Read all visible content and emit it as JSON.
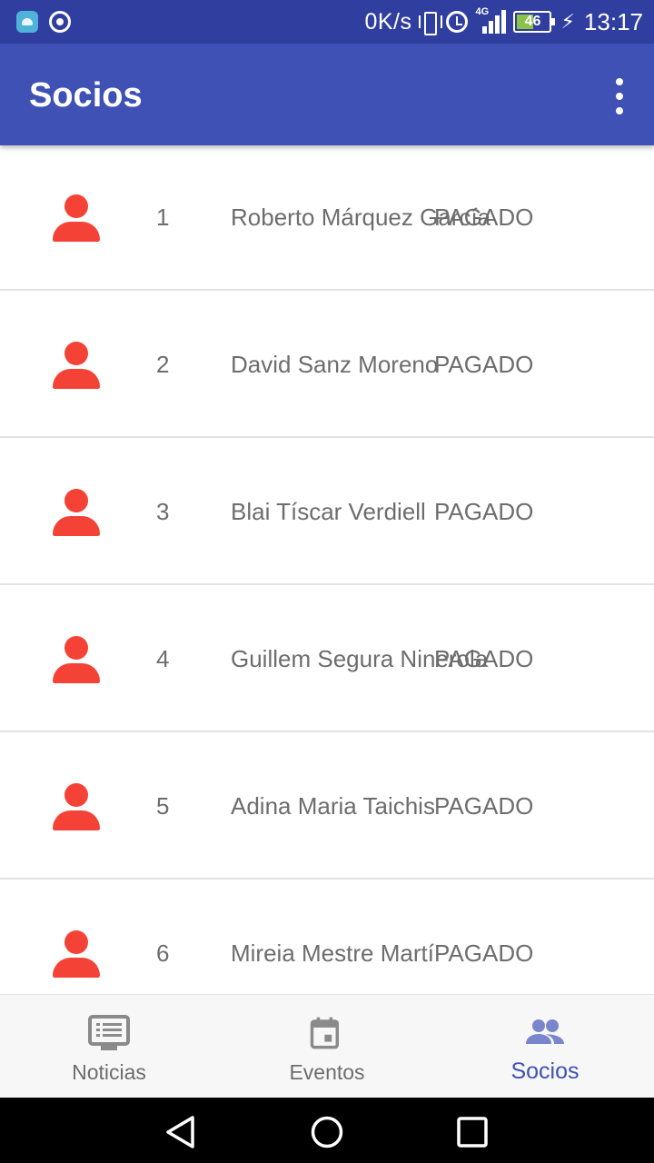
{
  "status_bar": {
    "net_speed": "0K/s",
    "network_type": "4G",
    "battery_level": "46",
    "time": "13:17"
  },
  "app_bar": {
    "title": "Socios",
    "overflow_icon": "more-vert-icon"
  },
  "members": [
    {
      "num": "1",
      "name": "Roberto Márquez García",
      "status": "PAGADO"
    },
    {
      "num": "2",
      "name": "David Sanz Moreno",
      "status": "PAGADO"
    },
    {
      "num": "3",
      "name": "Blai Tíscar Verdiell",
      "status": "PAGADO"
    },
    {
      "num": "4",
      "name": "Guillem Segura Ninerola",
      "status": "PAGADO"
    },
    {
      "num": "5",
      "name": "Adina Maria Taichis",
      "status": "PAGADO"
    },
    {
      "num": "6",
      "name": "Mireia Mestre Martí",
      "status": "PAGADO"
    }
  ],
  "bottom_nav": {
    "items": [
      {
        "label": "Noticias",
        "icon": "news-icon",
        "active": false
      },
      {
        "label": "Eventos",
        "icon": "calendar-icon",
        "active": false
      },
      {
        "label": "Socios",
        "icon": "people-icon",
        "active": true
      }
    ]
  },
  "colors": {
    "primary": "#3f51b5",
    "primary_dark": "#303f9f",
    "accent_icon": "#f44336",
    "text_secondary": "#6d6d6d",
    "inactive_nav_icon": "#8a8a8a",
    "active_nav_icon": "#7986cb"
  }
}
